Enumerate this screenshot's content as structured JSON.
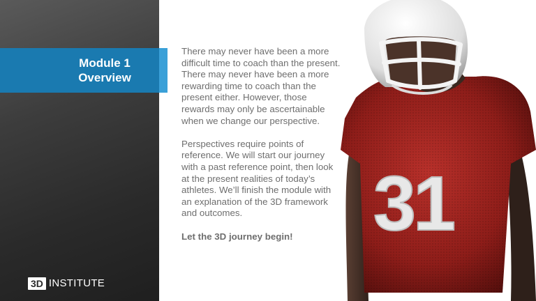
{
  "module": {
    "title_line1": "Module 1",
    "title_line2": "Overview"
  },
  "content": {
    "paragraph1": "There may never have been a more difficult time to coach than the present. There may never have been a more rewarding time to coach than the present either. However, those rewards may only be ascertainable when we change our perspective.",
    "paragraph2": "Perspectives require points of reference. We will start our journey with a past reference point, then look at the present realities of today’s athletes. We’ll finish the module with an explanation of the 3D framework and outcomes.",
    "closing": "Let the 3D journey begin!"
  },
  "logo": {
    "mark": "3D",
    "name": "INSTITUTE"
  },
  "image": {
    "jersey_number": "31"
  },
  "colors": {
    "banner_blue": "#1a7ab0",
    "banner_accent": "#3aa0d8",
    "panel_dark": "#2a2a2a",
    "body_text": "#6e6e6e",
    "jersey_red": "#a0221d"
  }
}
